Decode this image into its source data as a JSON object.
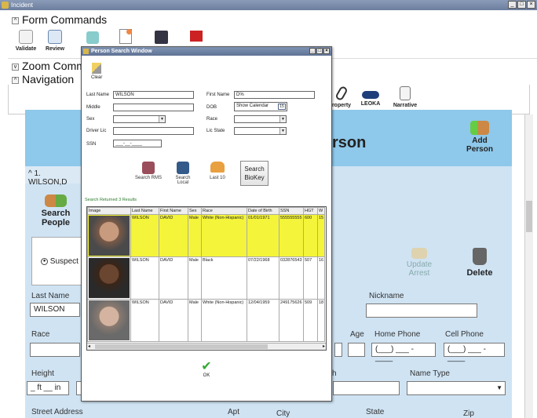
{
  "window": {
    "title": "Incident"
  },
  "sections": {
    "form_commands": "Form Commands",
    "zoom_commands": "Zoom Comma",
    "navigation": "Navigation"
  },
  "toolbar": [
    {
      "label": "Validate",
      "icon": "validate-icon"
    },
    {
      "label": "Review",
      "icon": "review-icon"
    },
    {
      "label": "",
      "icon": "print-icon"
    },
    {
      "label": "",
      "icon": "new-doc-icon"
    },
    {
      "label": "",
      "icon": "save-icon"
    },
    {
      "label": "",
      "icon": "exit-icon"
    }
  ],
  "nav_icons": [
    {
      "label": "roperty",
      "icon": "property-icon"
    },
    {
      "label": "LEOKA",
      "icon": "leoka-icon"
    },
    {
      "label": "Narrative",
      "icon": "narrative-icon"
    }
  ],
  "person": {
    "title": "rson",
    "add_person": "Add Person",
    "entry": "1. WILSON,D",
    "search_people": "Search People",
    "role_radio": "Suspect",
    "update_arrest": "Update Arrest",
    "delete": "Delete",
    "labels": {
      "last_name": "Last Name",
      "nickname": "Nickname",
      "race": "Race",
      "age": "Age",
      "home_phone": "Home Phone",
      "cell_phone": "Cell Phone",
      "height": "Height",
      "h": "h",
      "name_type": "Name Type",
      "street_address": "Street Address",
      "apt": "Apt",
      "city": "City",
      "state": "State",
      "zip": "Zip"
    },
    "values": {
      "last_name": "WILSON",
      "home_phone": "(___) ___ - ____",
      "cell_phone": "(___) ___ - ____",
      "height": "_ ft __ in"
    }
  },
  "dialog": {
    "title": "Person Search Window",
    "clear": "Clear",
    "labels": {
      "last_name": "Last Name",
      "first_name": "First Name",
      "middle": "Middle",
      "dob": "DOB",
      "sex": "Sex",
      "race": "Race",
      "driver_lic": "Driver Lic",
      "lic_state": "Lic State",
      "ssn": "SSN"
    },
    "values": {
      "last_name": "WILSON",
      "first_name": "D%",
      "dob": "Show Calendar",
      "ssn": "___-__-____"
    },
    "buttons": {
      "search_rms": "Search RMS",
      "search_local": "Search Local",
      "last_10": "Last 10",
      "search_biokey": "Search BioKey",
      "ok": "OK"
    },
    "results_label": "Search Returned 3 Results",
    "columns": [
      "Image",
      "Last Name",
      "First Name",
      "Sex",
      "Race",
      "Date of Birth",
      "SSN",
      "HGT",
      "W"
    ],
    "rows": [
      {
        "last": "WILSON",
        "first": "DAVID",
        "sex": "Male",
        "race": "White (Non-Hispanic)",
        "dob": "01/01/1971",
        "ssn": "555555555",
        "hgt": "600",
        "w": "15"
      },
      {
        "last": "WILSON",
        "first": "DAVID",
        "sex": "Male",
        "race": "Black",
        "dob": "07/22/1968",
        "ssn": "032876543",
        "hgt": "507",
        "w": "16"
      },
      {
        "last": "WILSON",
        "first": "DAVID",
        "sex": "Male",
        "race": "White (Non-Hispanic)",
        "dob": "12/04/1959",
        "ssn": "249175626",
        "hgt": "509",
        "w": "18"
      }
    ]
  }
}
